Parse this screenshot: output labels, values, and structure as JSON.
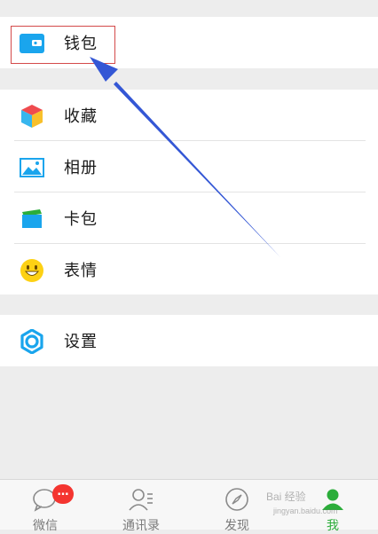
{
  "menu": {
    "wallet": {
      "label": "钱包"
    },
    "group2": [
      {
        "id": "favorites",
        "label": "收藏",
        "icon": "cube-icon"
      },
      {
        "id": "album",
        "label": "相册",
        "icon": "picture-icon"
      },
      {
        "id": "cards",
        "label": "卡包",
        "icon": "card-icon"
      },
      {
        "id": "stickers",
        "label": "表情",
        "icon": "smiley-icon"
      }
    ],
    "settings": {
      "label": "设置"
    }
  },
  "tabbar": {
    "chats": {
      "label": "微信",
      "badge": "…"
    },
    "contacts": {
      "label": "通讯录"
    },
    "discover": {
      "label": "发现"
    },
    "me": {
      "label": "我"
    }
  },
  "watermark": {
    "text": "Bai 经验",
    "sub": "jingyan.baidu.com"
  },
  "colors": {
    "accent_blue": "#1aa5ed",
    "active_green": "#2bad3a",
    "badge_red": "#f43530",
    "annotation_blue": "#3457d5",
    "highlight_red": "#d44a4a"
  }
}
